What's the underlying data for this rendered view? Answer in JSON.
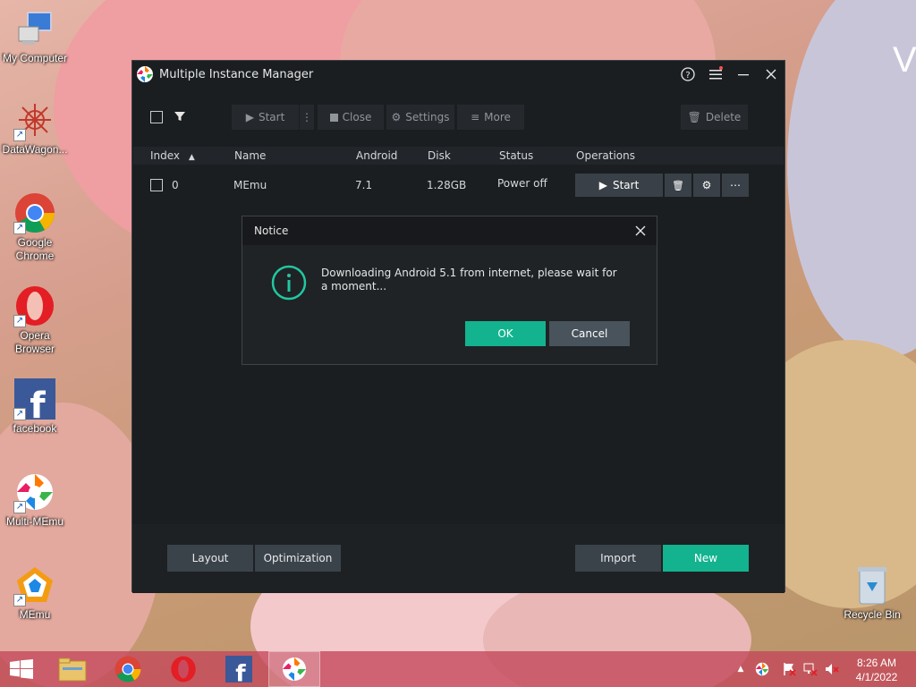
{
  "desktop": {
    "icons": [
      {
        "label": "My Computer",
        "icon": "computer-icon"
      },
      {
        "label": "DataWagon...",
        "icon": "datawagon-icon"
      },
      {
        "label": "Google Chrome",
        "icon": "chrome-icon"
      },
      {
        "label": "Opera Browser",
        "icon": "opera-icon"
      },
      {
        "label": "facebook",
        "icon": "facebook-icon"
      },
      {
        "label": "Multi-MEmu",
        "icon": "multi-memu-icon"
      },
      {
        "label": "MEmu",
        "icon": "memu-icon"
      },
      {
        "label": "Recycle Bin",
        "icon": "recycle-bin-icon"
      }
    ],
    "wallpaper_text": "V"
  },
  "window": {
    "title": "Multiple Instance Manager",
    "toolbar": {
      "start": "Start",
      "close": "Close",
      "settings": "Settings",
      "more": "More",
      "delete": "Delete"
    },
    "table": {
      "headers": [
        "Index",
        "Name",
        "Android",
        "Disk",
        "Status",
        "Operations"
      ],
      "rows": [
        {
          "index": "0",
          "name": "MEmu",
          "android": "7.1",
          "disk": "1.28GB",
          "status": "Power off",
          "start": "Start"
        }
      ]
    },
    "footer": {
      "layout": "Layout",
      "optimization": "Optimization",
      "import": "Import",
      "new": "New"
    }
  },
  "dialog": {
    "title": "Notice",
    "message": "Downloading Android 5.1 from internet, please wait for a moment...",
    "ok": "OK",
    "cancel": "Cancel"
  },
  "taskbar": {
    "time": "8:26 AM",
    "date": "4/1/2022"
  },
  "colors": {
    "accent_teal": "#13b38f",
    "dialog_teal_icon": "#22c7a0",
    "window_bg": "#1b1e21",
    "taskbar": "#c4465a"
  }
}
